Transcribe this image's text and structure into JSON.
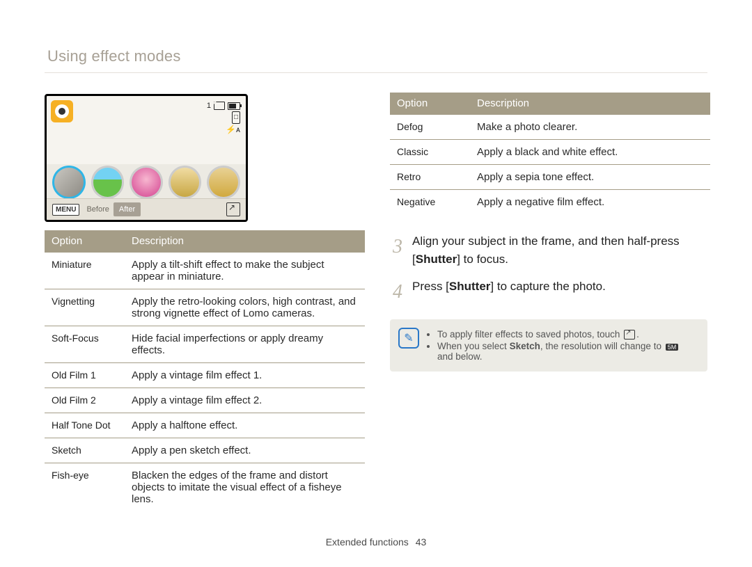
{
  "page_title": "Using effect modes",
  "footer": {
    "section": "Extended functions",
    "page": "43"
  },
  "screen": {
    "count": "1",
    "bar": {
      "menu": "MENU",
      "before": "Before",
      "after": "After"
    }
  },
  "table1": {
    "headers": [
      "Option",
      "Description"
    ],
    "rows": [
      {
        "option": "Miniature",
        "desc": "Apply a tilt-shift effect to make the subject appear in miniature."
      },
      {
        "option": "Vignetting",
        "desc": "Apply the retro-looking colors, high contrast, and strong vignette effect of Lomo cameras."
      },
      {
        "option": "Soft-Focus",
        "desc": "Hide facial imperfections or apply dreamy effects."
      },
      {
        "option": "Old Film 1",
        "desc": "Apply a vintage film effect 1."
      },
      {
        "option": "Old Film 2",
        "desc": "Apply a vintage film effect 2."
      },
      {
        "option": "Half Tone Dot",
        "desc": "Apply a halftone effect."
      },
      {
        "option": "Sketch",
        "desc": "Apply a pen sketch effect."
      },
      {
        "option": "Fish-eye",
        "desc": "Blacken the edges of the frame and distort objects to imitate the visual effect of a fisheye lens."
      }
    ]
  },
  "table2": {
    "headers": [
      "Option",
      "Description"
    ],
    "rows": [
      {
        "option": "Defog",
        "desc": "Make a photo clearer."
      },
      {
        "option": "Classic",
        "desc": "Apply a black and white effect."
      },
      {
        "option": "Retro",
        "desc": "Apply a sepia tone effect."
      },
      {
        "option": "Negative",
        "desc": "Apply a negative film effect."
      }
    ]
  },
  "steps": {
    "s3": {
      "num": "3",
      "pre": "Align your subject in the frame, and then half-press [",
      "key": "Shutter",
      "post": "] to focus."
    },
    "s4": {
      "num": "4",
      "pre": "Press [",
      "key": "Shutter",
      "post": "] to capture the photo."
    }
  },
  "note": {
    "b1a": "To apply filter effects to saved photos, touch ",
    "b1b": ".",
    "b2a": "When you select ",
    "b2bold": "Sketch",
    "b2b": ", the resolution will change to ",
    "b2res": "5M",
    "b2c": " and below."
  }
}
